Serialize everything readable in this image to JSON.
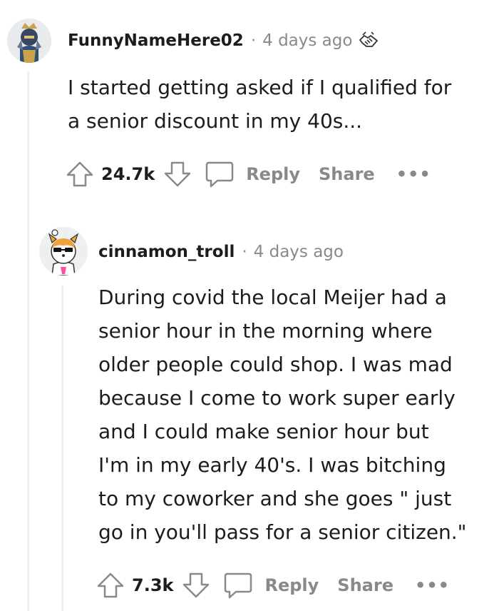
{
  "comments": [
    {
      "author": "FunnyNameHere02",
      "separator": "·",
      "time": "4 days ago",
      "body_lines": [
        "I started getting asked if I qualified for",
        "a senior discount in my 40s..."
      ],
      "votes": "24.7k",
      "reply_label": "Reply",
      "share_label": "Share",
      "more_label": "•••",
      "avatar_icon": "knight-avatar-icon",
      "award_icon": "handshake-award-icon"
    },
    {
      "author": "cinnamon_troll",
      "separator": "·",
      "time": "4 days ago",
      "body_lines": [
        "During covid the local Meijer had a",
        "senior hour in the morning where",
        "older people could shop. I was mad",
        "because I come to work super early",
        "and I could make senior hour but",
        "I'm in my early 40's. I was bitching",
        "to my coworker and she goes \" just",
        "go in you'll pass for a senior citizen.\""
      ],
      "votes": "7.3k",
      "reply_label": "Reply",
      "share_label": "Share",
      "more_label": "•••",
      "avatar_icon": "shiba-sunglasses-avatar-icon"
    }
  ],
  "colors": {
    "text": "#1c1c1c",
    "muted": "#878a8c",
    "thread_line": "#edeff1"
  }
}
